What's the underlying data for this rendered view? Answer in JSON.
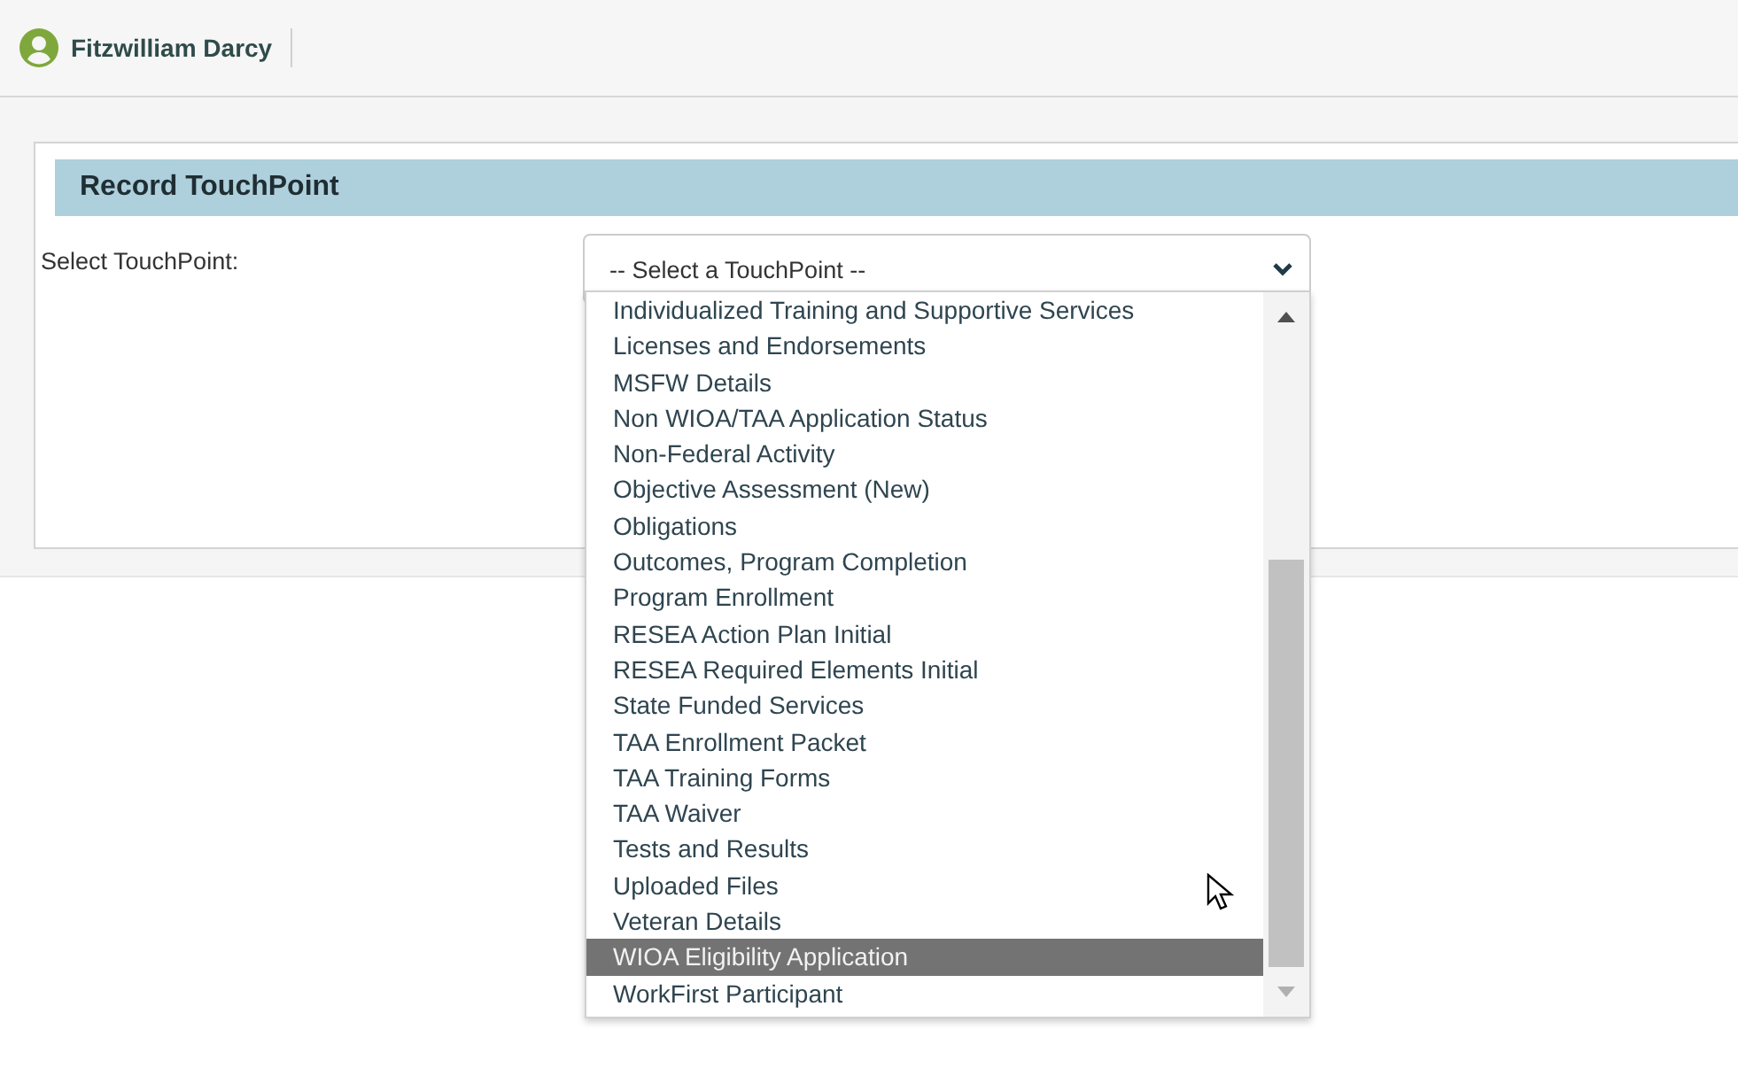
{
  "user": {
    "name": "Fitzwilliam Darcy"
  },
  "section": {
    "title": "Record TouchPoint"
  },
  "field": {
    "label": "Select TouchPoint:",
    "value": "-- Select a TouchPoint --",
    "expanded": true
  },
  "options": [
    {
      "label": "Individualized Training and Supportive Services",
      "selected": false
    },
    {
      "label": "Licenses and Endorsements",
      "selected": false
    },
    {
      "label": "MSFW Details",
      "selected": false
    },
    {
      "label": "Non WIOA/TAA Application Status",
      "selected": false
    },
    {
      "label": "Non-Federal Activity",
      "selected": false
    },
    {
      "label": "Objective Assessment (New)",
      "selected": false
    },
    {
      "label": "Obligations",
      "selected": false
    },
    {
      "label": "Outcomes, Program Completion",
      "selected": false
    },
    {
      "label": "Program Enrollment",
      "selected": false
    },
    {
      "label": "RESEA Action Plan Initial",
      "selected": false
    },
    {
      "label": "RESEA Required Elements Initial",
      "selected": false
    },
    {
      "label": "State Funded Services",
      "selected": false
    },
    {
      "label": "TAA Enrollment Packet",
      "selected": false
    },
    {
      "label": "TAA Training Forms",
      "selected": false
    },
    {
      "label": "TAA Waiver",
      "selected": false
    },
    {
      "label": "Tests and Results",
      "selected": false
    },
    {
      "label": "Uploaded Files",
      "selected": false
    },
    {
      "label": "Veteran Details",
      "selected": false
    },
    {
      "label": "WIOA Eligibility Application",
      "selected": true
    },
    {
      "label": "WorkFirst Participant",
      "selected": false
    }
  ]
}
